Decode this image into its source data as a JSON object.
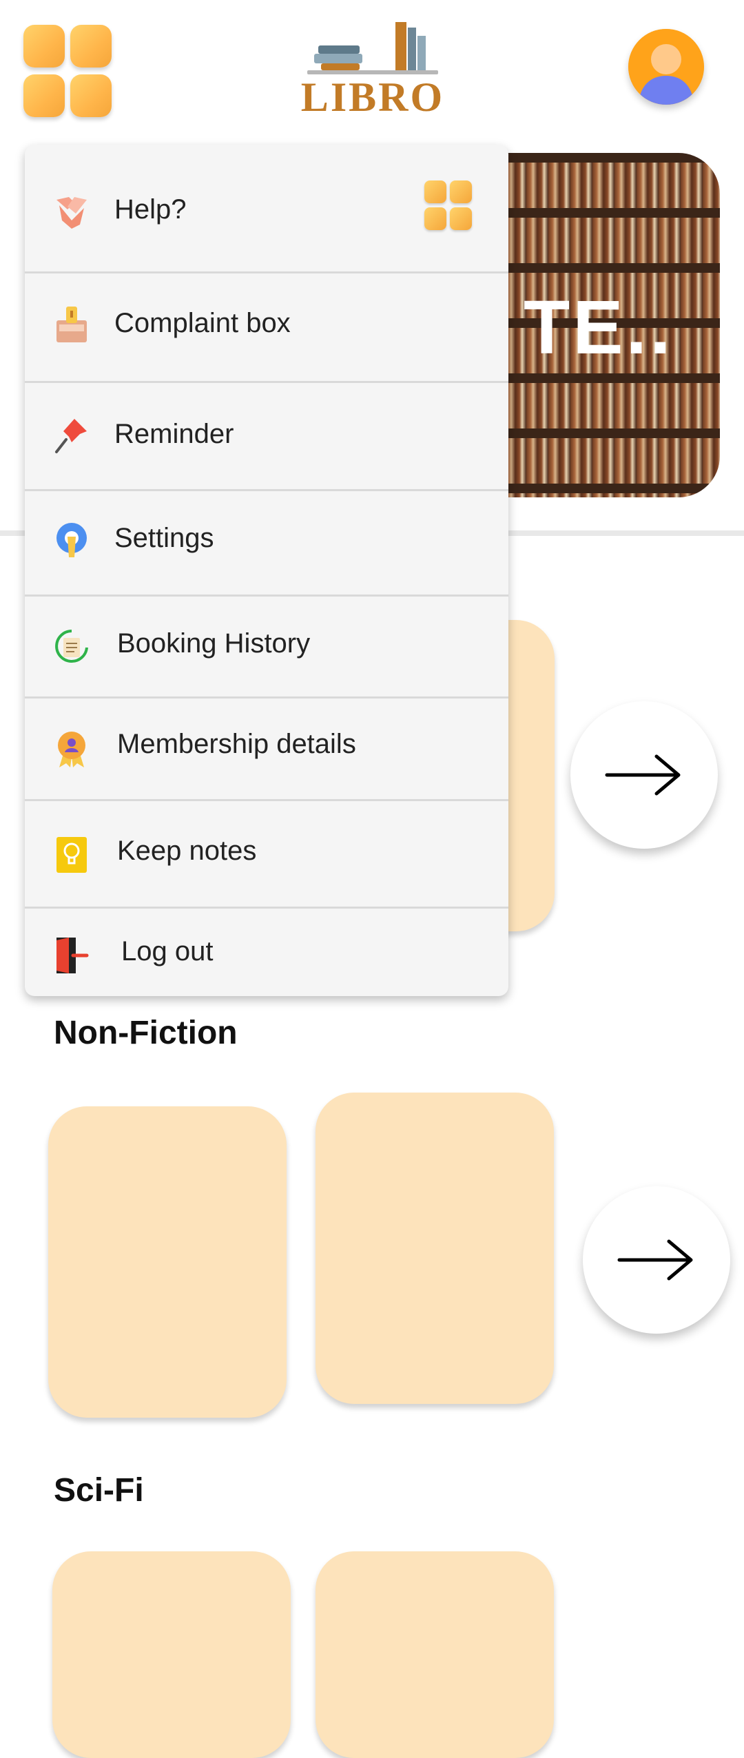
{
  "header": {
    "menu_icon": "grid-menu-icon",
    "logo_text": "LIBRO",
    "profile_icon": "user-avatar-icon"
  },
  "hero": {
    "text": "TE.."
  },
  "drawer": {
    "items": [
      {
        "label": "Help?",
        "icon": "handshake-icon"
      },
      {
        "label": "Complaint box",
        "icon": "complaint-box-icon"
      },
      {
        "label": "Reminder",
        "icon": "pushpin-icon"
      },
      {
        "label": "Settings",
        "icon": "gear-wrench-icon"
      },
      {
        "label": "Booking History",
        "icon": "history-doc-icon"
      },
      {
        "label": "Membership details",
        "icon": "membership-badge-icon"
      },
      {
        "label": "Keep notes",
        "icon": "lightbulb-note-icon"
      },
      {
        "label": "Log out",
        "icon": "exit-door-icon"
      }
    ]
  },
  "sections": [
    {
      "title": "Non-Fiction"
    },
    {
      "title": "Sci-Fi"
    }
  ],
  "colors": {
    "accent": "#ffb54a",
    "card": "#fde3bb",
    "drawer_bg": "#f5f5f5",
    "logo": "#c27b27"
  }
}
